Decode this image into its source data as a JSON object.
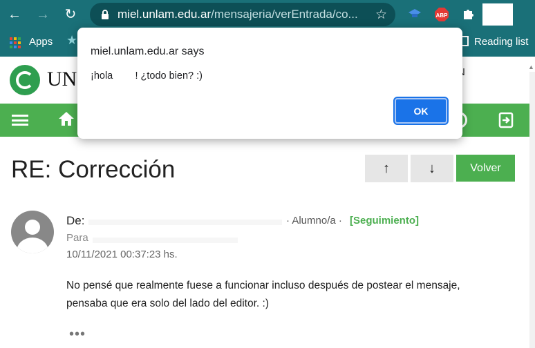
{
  "browser": {
    "url_host": "miel.unlam.edu.ar",
    "url_path": "/mensajeria/verEntrada/co...",
    "bookmarks": {
      "apps_label": "Apps",
      "reading_list_label": "Reading list"
    },
    "extensions": [
      "graduation-cap-icon",
      "adblock-plus-icon",
      "puzzle-icon"
    ]
  },
  "site": {
    "brand_fragment": "UN",
    "header_right_letter": "N",
    "header_right_sub": "n"
  },
  "message": {
    "title": "RE: Corrección",
    "volver_label": "Volver",
    "up_arrow": "↑",
    "down_arrow": "↓",
    "from_label": "De:",
    "role": "· Alumno/a ·",
    "tracking_link": "[Seguimiento]",
    "to_label": "Para",
    "date": "10/11/2021 00:37:23 hs.",
    "body": "No pensé que realmente fuese a funcionar incluso después de postear el mensaje, pensaba que era solo del lado del editor. :)",
    "more": "•••"
  },
  "dialog": {
    "title": "miel.unlam.edu.ar says",
    "message": "¡hola        ! ¿todo bien? :)",
    "ok_label": "OK"
  },
  "colors": {
    "chrome": "#1a7078",
    "brand_green": "#4caf50",
    "dialog_button": "#1a73e8"
  }
}
